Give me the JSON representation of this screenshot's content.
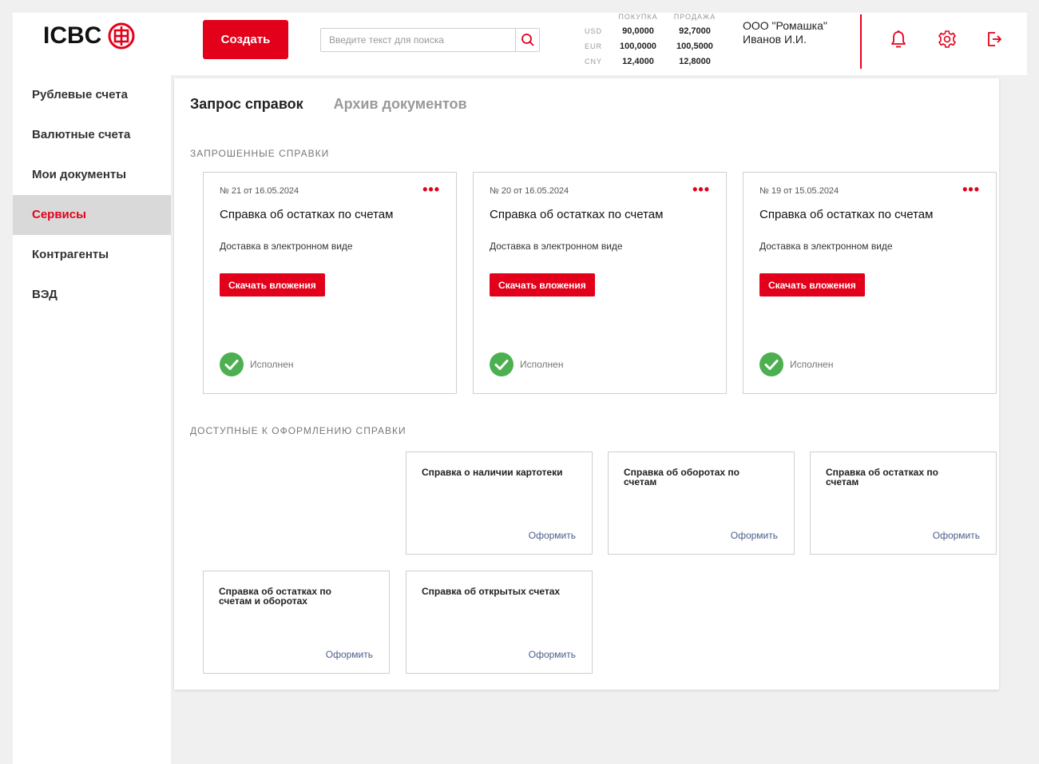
{
  "brand": {
    "logo_text": "ICBC",
    "accent": "#e2001a"
  },
  "header": {
    "create_label": "Создать",
    "search_placeholder": "Введите текст для поиска",
    "rates": {
      "buy_header": "ПОКУПКА",
      "sell_header": "ПРОДАЖА",
      "rows": [
        {
          "currency": "USD",
          "buy": "90,0000",
          "sell": "92,7000"
        },
        {
          "currency": "EUR",
          "buy": "100,0000",
          "sell": "100,5000"
        },
        {
          "currency": "CNY",
          "buy": "12,4000",
          "sell": "12,8000"
        }
      ]
    },
    "company": "ООО \"Ромашка\"",
    "user": "Иванов И.И.",
    "icons": [
      "bell-icon",
      "gear-icon",
      "logout-icon"
    ]
  },
  "sidebar": {
    "items": [
      {
        "label": "Рублевые счета",
        "active": false
      },
      {
        "label": "Валютные счета",
        "active": false
      },
      {
        "label": "Мои документы",
        "active": false
      },
      {
        "label": "Сервисы",
        "active": true
      },
      {
        "label": "Контрагенты",
        "active": false
      },
      {
        "label": "ВЭД",
        "active": false
      }
    ]
  },
  "main": {
    "tabs": [
      {
        "label": "Запрос справок",
        "active": true
      },
      {
        "label": "Архив документов",
        "active": false
      }
    ],
    "requested_title": "ЗАПРОШЕННЫЕ СПРАВКИ",
    "requested": [
      {
        "number": "№ 21 от 16.05.2024",
        "title": "Справка об остатках по счетам",
        "delivery": "Доставка в электронном виде",
        "button": "Скачать вложения",
        "status": "Исполнен"
      },
      {
        "number": "№ 20 от 16.05.2024",
        "title": "Справка об остатках по счетам",
        "delivery": "Доставка в электронном виде",
        "button": "Скачать вложения",
        "status": "Исполнен"
      },
      {
        "number": "№ 19 от 15.05.2024",
        "title": "Справка об остатках по счетам",
        "delivery": "Доставка в электронном виде",
        "button": "Скачать вложения",
        "status": "Исполнен"
      }
    ],
    "available_title": "ДОСТУПНЫЕ К ОФОРМЛЕНИЮ СПРАВКИ",
    "available": [
      {
        "title": "Справка о наличии картотеки",
        "action": "Оформить"
      },
      {
        "title": "Справка об оборотах по счетам",
        "action": "Оформить"
      },
      {
        "title": "Справка об остатках по счетам",
        "action": "Оформить"
      },
      {
        "title": "Справка об остатках по счетам и оборотах",
        "action": "Оформить"
      },
      {
        "title": "Справка об открытых счетах",
        "action": "Оформить"
      }
    ]
  }
}
